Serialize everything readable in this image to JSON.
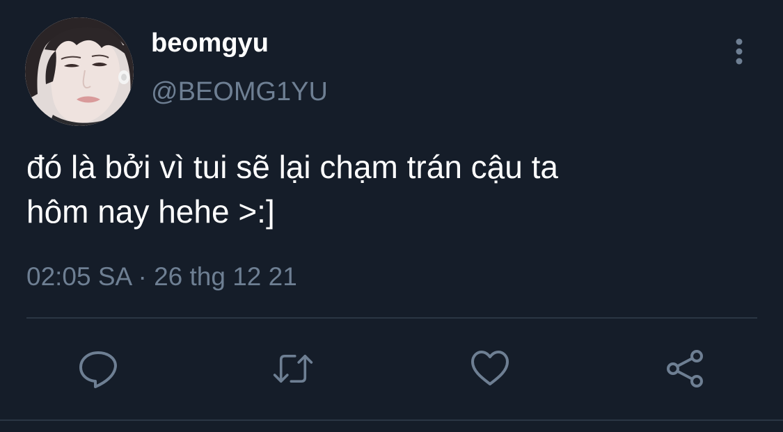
{
  "user": {
    "display_name": "beomgyu",
    "handle": "@BEOMG1YU",
    "avatar_icon": "profile-photo"
  },
  "tweet": {
    "text_lines": [
      "đó là bởi vì tui sẽ lại chạm trán cậu ta",
      "hôm nay hehe >:]"
    ],
    "timestamp": "02:05 SA · 26 thg 12 21"
  },
  "actions": [
    {
      "name": "reply",
      "icon": "comment-icon"
    },
    {
      "name": "retweet",
      "icon": "retweet-icon"
    },
    {
      "name": "like",
      "icon": "heart-icon"
    },
    {
      "name": "share",
      "icon": "share-icon"
    }
  ],
  "more_icon": "vertical-ellipsis-icon",
  "colors": {
    "background": "#151d29",
    "primary_text": "#ffffff",
    "secondary_text": "#6e7f93",
    "icon": "#6e7f93",
    "divider": "#2b3644"
  }
}
